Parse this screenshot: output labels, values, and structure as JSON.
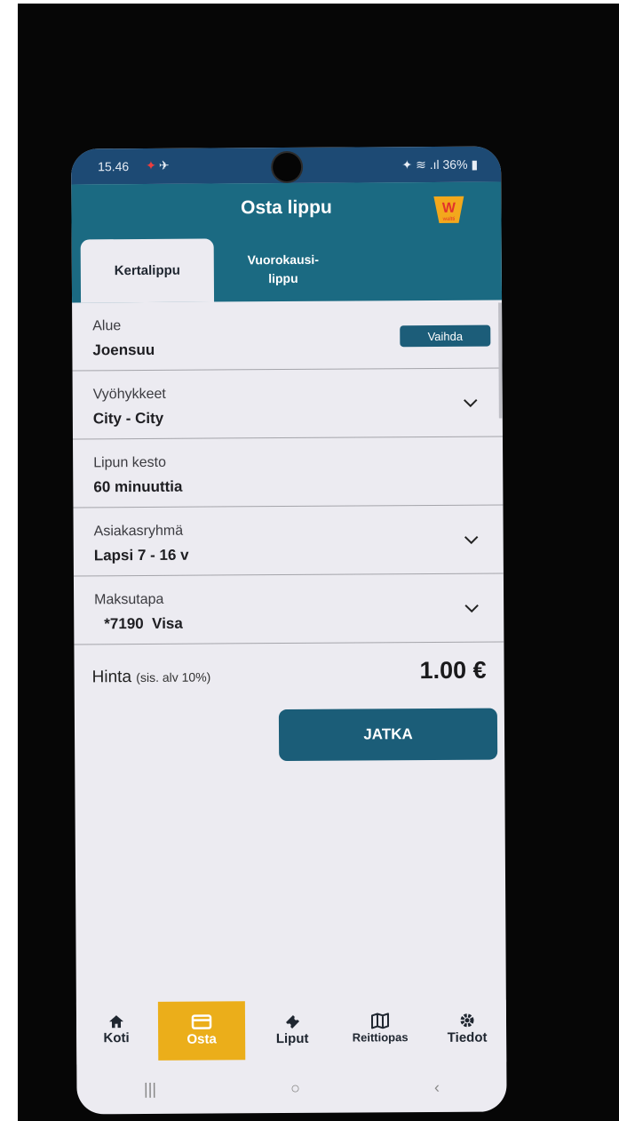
{
  "status_bar": {
    "time": "15.46",
    "notification_icons": "— ✈ ✦ ·",
    "right": "✦ ≋ .ıl 36%",
    "battery": "36%"
  },
  "header": {
    "title": "Osta lippu",
    "logo_text": "W",
    "logo_sub": "waltti"
  },
  "tabs": [
    {
      "label": "Kertalippu",
      "active": true
    },
    {
      "label_line1": "Vuorokausi-",
      "label_line2": "lippu",
      "active": false
    }
  ],
  "fields": {
    "area": {
      "label": "Alue",
      "value": "Joensuu",
      "button": "Vaihda"
    },
    "zones": {
      "label": "Vyöhykkeet",
      "value": "City - City"
    },
    "duration": {
      "label": "Lipun kesto",
      "value": "60 minuuttia"
    },
    "customer_group": {
      "label": "Asiakasryhmä",
      "value": "Lapsi 7 - 16 v"
    },
    "payment": {
      "label": "Maksutapa",
      "value": "*7190  Visa"
    }
  },
  "price": {
    "label": "Hinta",
    "vat_note": "(sis. alv 10%)",
    "value": "1.00 €"
  },
  "continue_button": "JATKA",
  "bottom_nav": [
    {
      "label": "Koti",
      "icon": "home-icon"
    },
    {
      "label": "Osta",
      "icon": "card-icon",
      "active": true
    },
    {
      "label": "Liput",
      "icon": "ticket-icon"
    },
    {
      "label": "Reittiopas",
      "icon": "map-icon"
    },
    {
      "label": "Tiedot",
      "icon": "gear-icon"
    }
  ],
  "system_nav": {
    "recents": "|||",
    "home": "○",
    "back": "‹"
  },
  "colors": {
    "header": "#1b6a82",
    "status_bar": "#1d4a74",
    "button": "#1b5d78",
    "active_nav": "#ebae1a",
    "background": "#ecebf1"
  }
}
